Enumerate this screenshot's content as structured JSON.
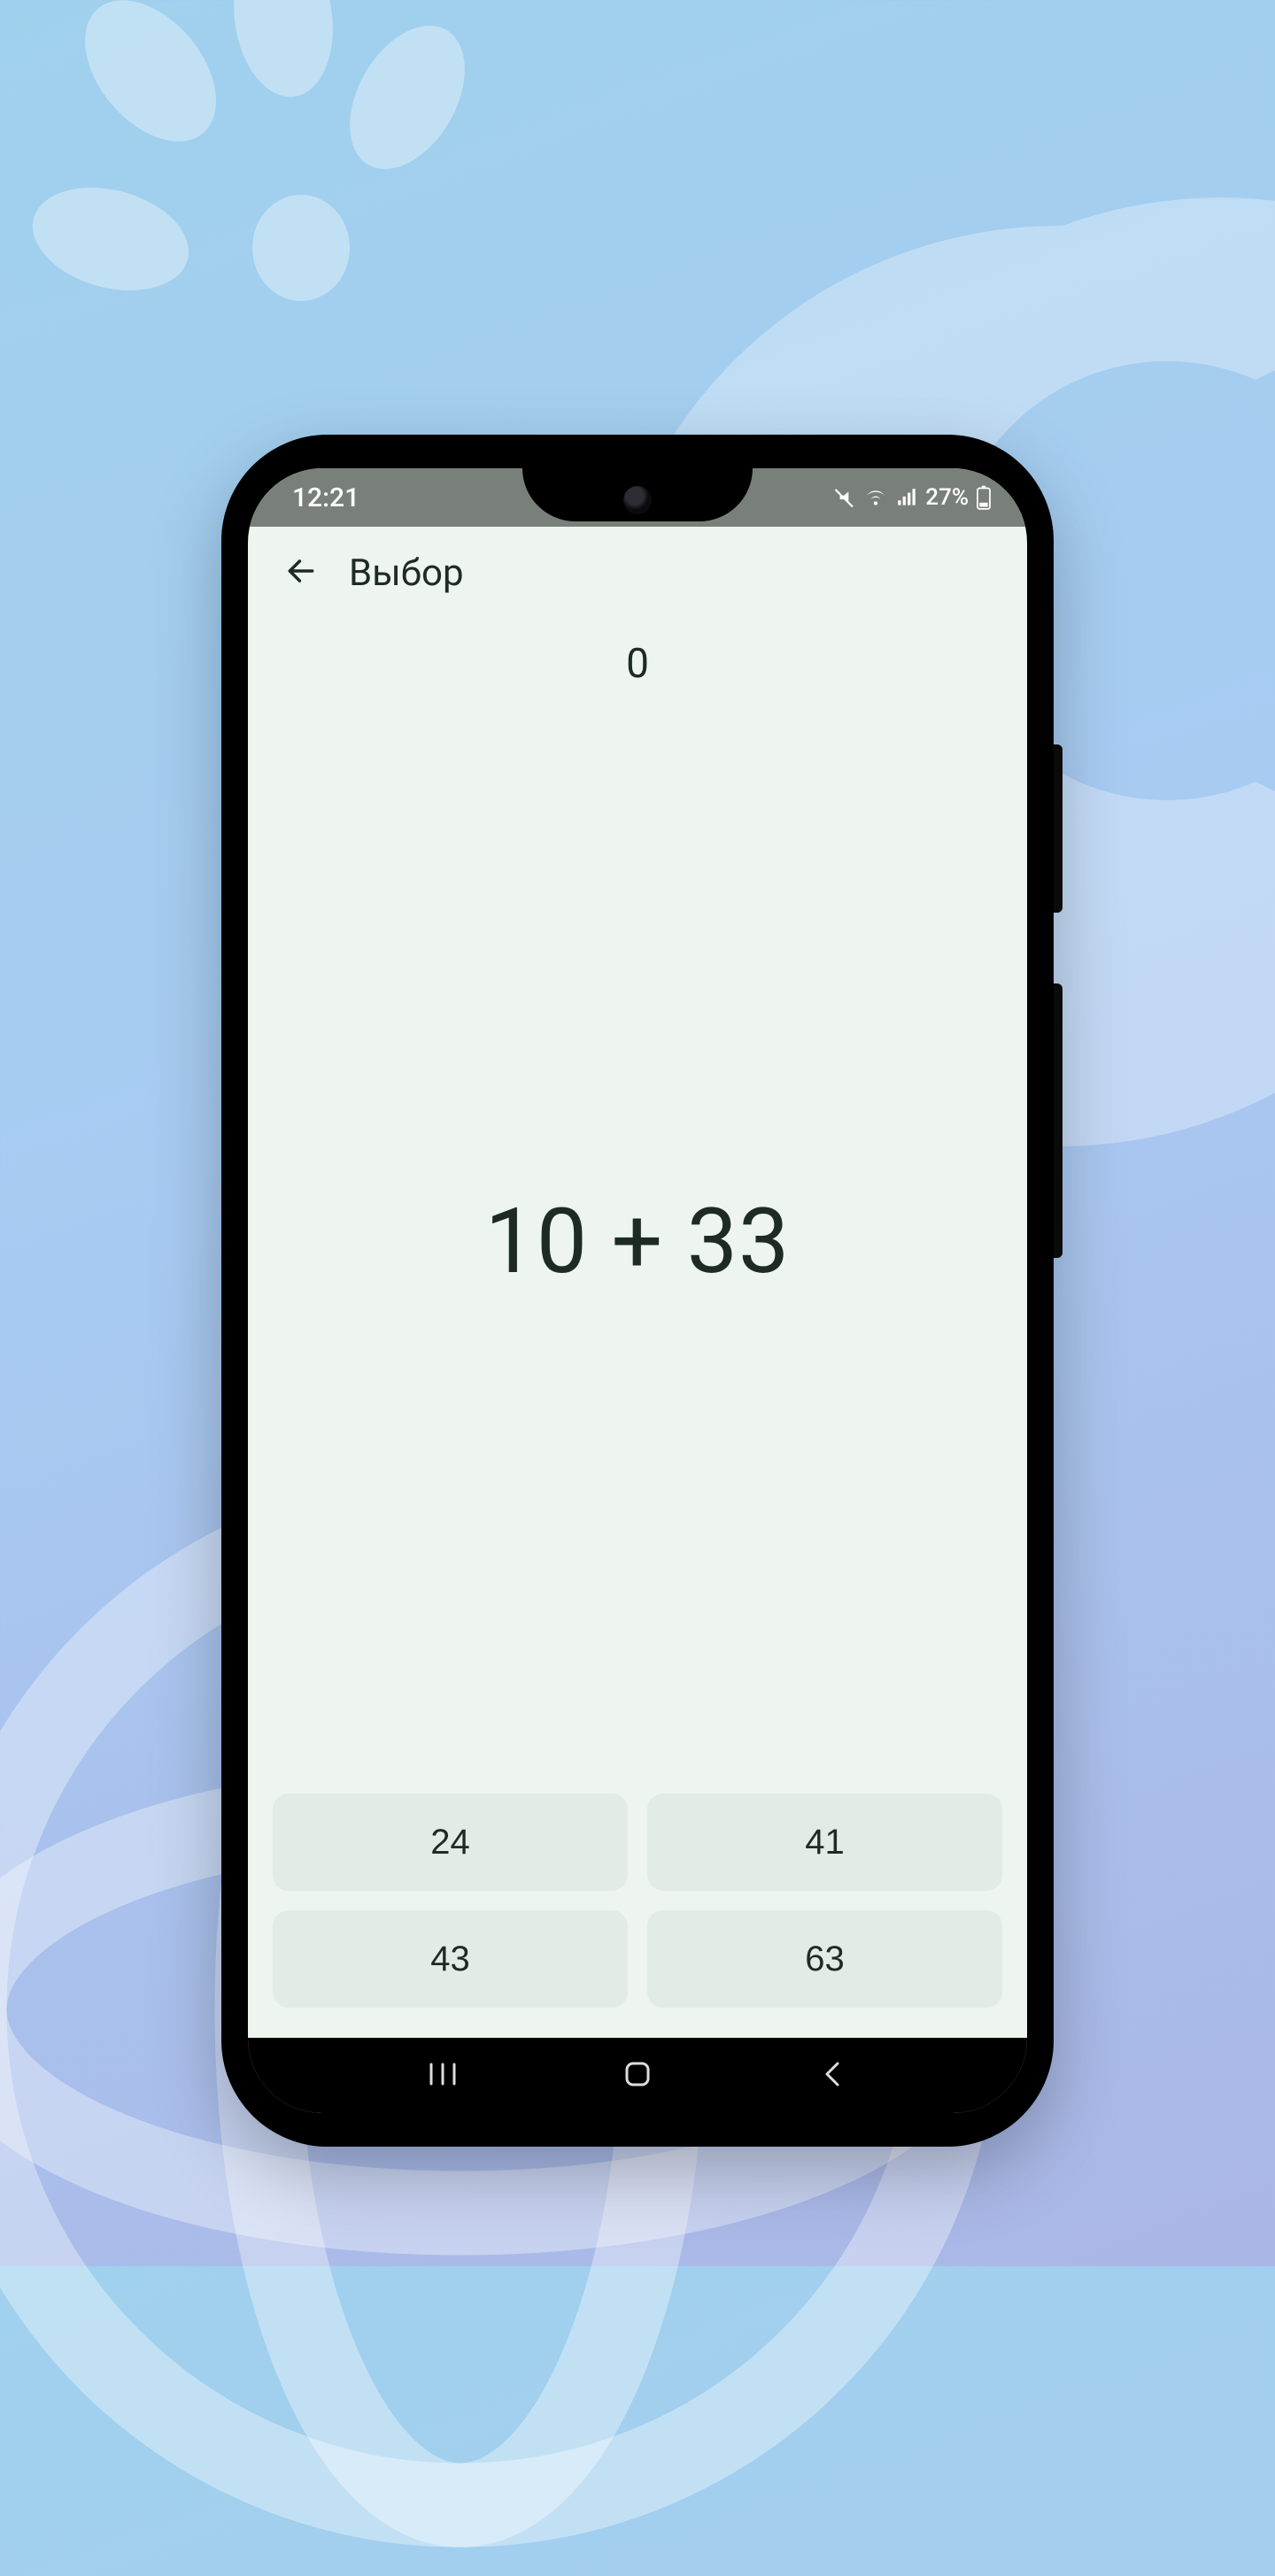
{
  "status_bar": {
    "time": "12:21",
    "battery_text": "27%"
  },
  "app_bar": {
    "title": "Выбор"
  },
  "game": {
    "score": "0",
    "question": "10 + 33",
    "answers": [
      "24",
      "41",
      "43",
      "63"
    ]
  }
}
